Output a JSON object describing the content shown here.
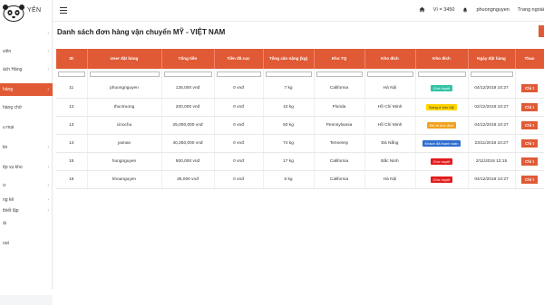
{
  "brand": {
    "logo_text": "YÊN"
  },
  "sidebar": {
    "items": [
      {
        "label": "",
        "chevron": "›"
      },
      {
        "label": "viên",
        "chevron": "›"
      },
      {
        "label": "ách Hàng",
        "chevron": "›"
      },
      {
        "label": "hàng",
        "chevron": "›"
      },
      {
        "label": "hàng chờ",
        "chevron": ""
      },
      {
        "label": "u mại",
        "chevron": ""
      },
      {
        "label": "tin",
        "chevron": "›"
      },
      {
        "label": "ệp vụ kho",
        "chevron": "›"
      },
      {
        "label": "ư",
        "chevron": "›"
      },
      {
        "label": "ng kê",
        "chevron": "›"
      },
      {
        "label": "thiết lập",
        "chevron": "›"
      },
      {
        "label": "ải",
        "chevron": ""
      },
      {
        "label": "out",
        "chevron": ""
      }
    ]
  },
  "header": {
    "wallet": "Ví = 3450",
    "username": "phuongnguyen",
    "extra": "Trang ngoài"
  },
  "main": {
    "title": "Danh sách đơn hàng vận chuyển MỸ - VIỆT NAM",
    "columns": [
      "ID",
      "User đặt hàng",
      "Tổng tiền",
      "Tiền đã cọc",
      "Tổng cân nặng (kg)",
      "Kho TQ",
      "Kho đích",
      "Kho đích",
      "Ngày đặt hàng",
      "Thao"
    ],
    "rows": [
      {
        "id": "11",
        "user": "phuongnguyen",
        "total": "125,000 vnđ",
        "deposit": "0 vnđ",
        "weight": "7 kg",
        "kho_tq": "California",
        "kho_dich": "Hà Nội",
        "status": "Chờ duyệt",
        "status_bg": "#33c3a4",
        "status_fg": "#ffffff",
        "date": "04/12/2018 10:27",
        "action": "Chi t"
      },
      {
        "id": "12",
        "user": "thuctruong",
        "total": "200,000 vnđ",
        "deposit": "0 vnđ",
        "weight": "10 kg",
        "kho_tq": "Florida",
        "kho_dich": "Hồ Chí Minh",
        "status": "Đang ở kho Mỹ",
        "status_bg": "#ffd400",
        "status_fg": "#333333",
        "date": "02/12/2018 10:27",
        "action": "Chi t"
      },
      {
        "id": "13",
        "user": "cinochu",
        "total": "25,000,000 vnđ",
        "deposit": "0 vnđ",
        "weight": "50 kg",
        "kho_tq": "Pennsylvania",
        "kho_dich": "Hồ Chí Minh",
        "status": "Đã về kho đích",
        "status_bg": "#f0a11e",
        "status_fg": "#ffffff",
        "date": "04/12/2018 10:27",
        "action": "Chi t"
      },
      {
        "id": "14",
        "user": "yaman",
        "total": "40,250,000 vnđ",
        "deposit": "0 vnđ",
        "weight": "74 kg",
        "kho_tq": "Tennessy",
        "kho_dich": "Đà Nẵng",
        "status": "Khách đã thanh toán",
        "status_bg": "#2f6fd0",
        "status_fg": "#ffffff",
        "date": "23/11/2018 10:27",
        "action": "Chi t"
      },
      {
        "id": "15",
        "user": "hungnguyen",
        "total": "500,000 vnđ",
        "deposit": "0 vnđ",
        "weight": "17 kg",
        "kho_tq": "California",
        "kho_dich": "Bắc Ninh",
        "status": "Chờ duyệt",
        "status_bg": "#e21b1b",
        "status_fg": "#ffffff",
        "date": "2/11/2018 13:15",
        "action": "Chi t"
      },
      {
        "id": "16",
        "user": "khoanguyen",
        "total": "35,000 vnđ",
        "deposit": "0 vnđ",
        "weight": "5 kg",
        "kho_tq": "California",
        "kho_dich": "Hà Nội",
        "status": "Chờ duyệt",
        "status_bg": "#e21b1b",
        "status_fg": "#ffffff",
        "date": "04/12/2018 10:27",
        "action": "Chi t"
      }
    ]
  },
  "colors": {
    "accent": "#e05a35"
  }
}
